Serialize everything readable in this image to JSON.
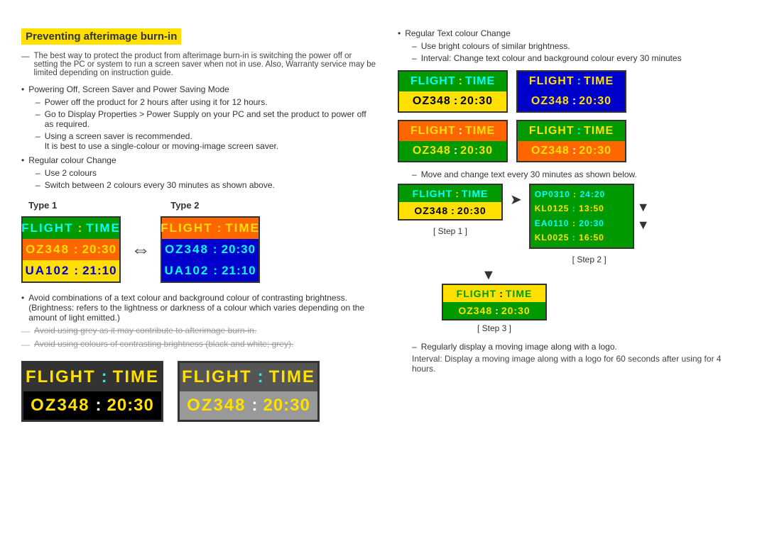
{
  "title": "Preventing afterimage burn-in",
  "intro_dashes": [
    "The best way to protect the product from afterimage burn-in is switching the power off or setting the PC or system to run a screen saver when not in use. Also, Warranty service may be limited depending on instruction guide."
  ],
  "bullets": [
    {
      "text": "Powering Off, Screen Saver and Power Saving Mode",
      "subs": [
        "Power off the product for 2 hours after using it for 12 hours.",
        "Go to Display Properties > Power Supply on your PC and set the product to power off as required.",
        "Using a screen saver is recommended. It is best to use a single-colour or moving-image screen saver."
      ]
    },
    {
      "text": "Regular colour Change",
      "subs": [
        "Use 2 colours",
        "Switch between 2 colours every 30 minutes as shown above."
      ]
    }
  ],
  "type1_label": "Type 1",
  "type2_label": "Type 2",
  "flight_label": "FLIGHT",
  "time_label": "TIME",
  "colon_label": ":",
  "oz348": "OZ348",
  "time1": "20:30",
  "ua102": "UA102",
  "time2": "21:10",
  "avoid_text1": "Avoid using grey as it may contribute to afterimage burn-in.",
  "avoid_text2": "Avoid using colours of contrasting brightness (black and white; grey).",
  "bottom_board1_header": [
    "FLIGHT",
    ":",
    "TIME"
  ],
  "bottom_board1_data": [
    "OZ348",
    ":",
    "20:30"
  ],
  "bottom_board2_header": [
    "FLIGHT",
    ":",
    "TIME"
  ],
  "bottom_board2_data": [
    "OZ348",
    ":",
    "20:30"
  ],
  "right_section": {
    "bullet": "Regular Text colour Change",
    "sub1": "Use bright colours of similar brightness.",
    "sub2": "Interval: Change text colour and background colour every 30 minutes"
  },
  "right_boards": [
    {
      "header": [
        "FLIGHT",
        ":",
        "TIME"
      ],
      "data": [
        "OZ348",
        ":",
        "20:30"
      ]
    },
    {
      "header": [
        "FLIGHT",
        ":",
        "TIME"
      ],
      "data": [
        "OZ348",
        ":",
        "20:30"
      ]
    },
    {
      "header": [
        "FLIGHT",
        ":",
        "TIME"
      ],
      "data": [
        "OZ348",
        ":",
        "20:30"
      ]
    },
    {
      "header": [
        "FLIGHT",
        ":",
        "TIME"
      ],
      "data": [
        "OZ348",
        ":",
        "20:30"
      ]
    }
  ],
  "move_text": "Move and change text every 30 minutes as shown below.",
  "step1_label": "[ Step 1 ]",
  "step2_label": "[ Step 2 ]",
  "step3_label": "[ Step 3 ]",
  "step1_board": {
    "header": [
      "FLIGHT",
      ":",
      "TIME"
    ],
    "data": [
      "OZ348",
      ":",
      "20:30"
    ]
  },
  "step2_lines": [
    "OP0310 : 24:20",
    "KL0125 : 13:50",
    "EA0110 : 20:30",
    "KL0025 : 16:50"
  ],
  "step3_board": {
    "header": [
      "FLIGHT",
      ":",
      "TIME"
    ],
    "data": [
      "OZ348",
      ":",
      "20:30"
    ]
  },
  "regular_display_bullet": "Regularly display a moving image along with a logo.",
  "regular_display_sub": "Interval: Display a moving image along with a logo for 60 seconds after using for 4 hours."
}
